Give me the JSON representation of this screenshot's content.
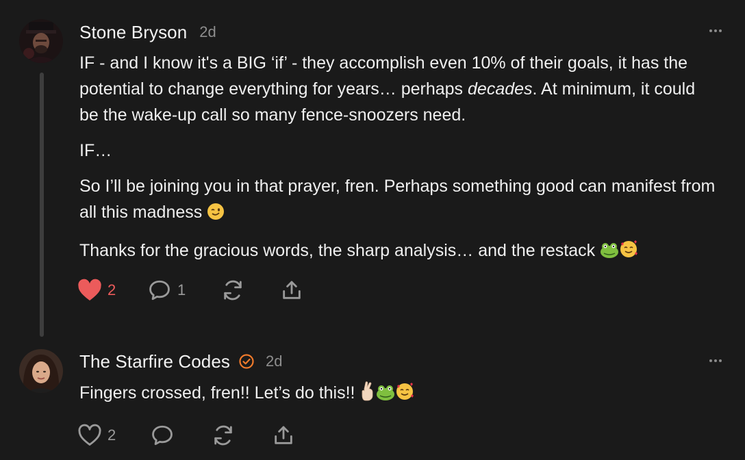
{
  "comments": [
    {
      "author": "Stone Bryson",
      "time": "2d",
      "paragraphs": {
        "p1_a": "IF - and I know it's a BIG ‘if’ - they accomplish even 10% of their goals, it has the potential to change everything for years… perhaps ",
        "p1_em": "decades",
        "p1_b": ". At minimum, it could be the wake-up call so many fence-snoozers need.",
        "p2": "IF…",
        "p3": "So I’ll be joining you in that prayer, fren. Perhaps something good can manifest from all this madness",
        "p4": "Thanks for the gracious words, the sharp analysis… and the restack"
      },
      "emoji": {
        "p3": "winking-face",
        "p4": [
          "frog-face",
          "smiling-face-with-hearts"
        ]
      },
      "likes": "2",
      "liked": true,
      "replies": "1"
    },
    {
      "author": "The Starfire Codes",
      "time": "2d",
      "verified": true,
      "text": "Fingers crossed, fren!! Let’s do this!!",
      "emoji": [
        "crossed-fingers",
        "frog-face",
        "smiling-face-with-hearts"
      ],
      "likes": "2",
      "liked": false
    }
  ],
  "colors": {
    "background": "#1a1a1a",
    "text": "#efefef",
    "muted": "#8e8e8e",
    "like_active": "#ec5b5b",
    "verified_accent": "#f07a2b",
    "thread_line": "#3d3d3d"
  }
}
